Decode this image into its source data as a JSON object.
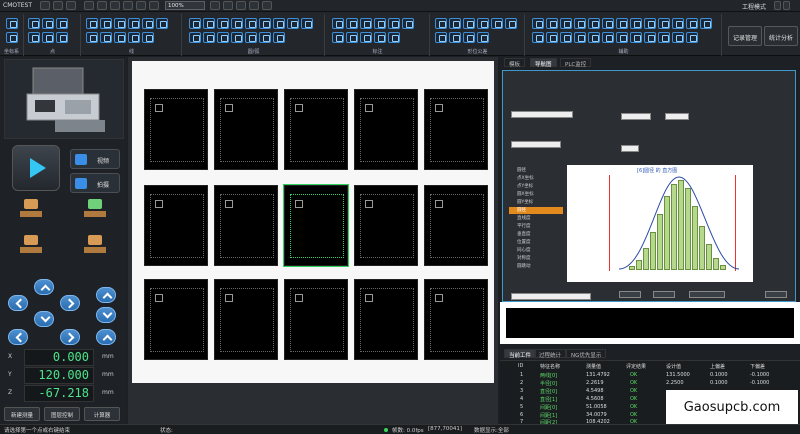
{
  "titlebar": {
    "menu": "CMOTEST",
    "zoom": "100%",
    "mode": "工程模式"
  },
  "toolbar": {
    "groups": [
      "坐标系",
      "点",
      "线",
      "圆/弧",
      "标注",
      "形位公差",
      "辅助"
    ],
    "record_label": "记录管理",
    "stats_label": "统计分析"
  },
  "left": {
    "measure_label": "视频",
    "capture_label": "拍摄",
    "coords": [
      {
        "axis": "X",
        "value": "0.000",
        "unit": "mm"
      },
      {
        "axis": "Y",
        "value": "120.000",
        "unit": "mm"
      },
      {
        "axis": "Z",
        "value": "-67.218",
        "unit": "mm"
      }
    ],
    "buttons": [
      "新建测量",
      "图层控制",
      "计算器"
    ]
  },
  "right_tabs": [
    "模板",
    "导航图",
    "PLC监控"
  ],
  "spc": {
    "chart_title": "[6]圆径 的 直方图",
    "list_items": [
      "圆径",
      "点X坐标",
      "点Y坐标",
      "圆X坐标",
      "圆Y坐标",
      "圆径",
      "直线度",
      "平行度",
      "垂直度",
      "位置度",
      "同心度",
      "对称度",
      "圆跳动"
    ],
    "list_active": 5
  },
  "grid": {
    "tabs": [
      "当前工件",
      "过程统计",
      "NG优先显示"
    ],
    "headers": [
      "ID",
      "特征名称",
      "测量值",
      "评定结果",
      "设计值",
      "上偏差",
      "下偏差"
    ],
    "rows": [
      [
        "1",
        "两线[0]",
        "131.4792",
        "OK",
        "131.5000",
        "0.1000",
        "-0.1000"
      ],
      [
        "2",
        "半径[0]",
        "2.2619",
        "OK",
        "2.2500",
        "0.1000",
        "-0.1000"
      ],
      [
        "3",
        "直径[0]",
        "4.5498",
        "OK",
        "",
        "",
        ""
      ],
      [
        "4",
        "直径[1]",
        "4.5608",
        "OK",
        "",
        "",
        ""
      ],
      [
        "5",
        "间距[0]",
        "51.0058",
        "OK",
        "",
        "",
        ""
      ],
      [
        "6",
        "间距[1]",
        "34.0079",
        "OK",
        "",
        "",
        ""
      ],
      [
        "7",
        "间距[2]",
        "108.4202",
        "OK",
        "",
        "",
        ""
      ]
    ]
  },
  "watermark": "Gaosupcb.com",
  "status": {
    "hint": "请选择第一个点或右键结束",
    "status_label": "状态:",
    "fps": "帧数: 0.0fps",
    "pos": "[877,70041]",
    "mode": "数据显示:全部"
  }
}
